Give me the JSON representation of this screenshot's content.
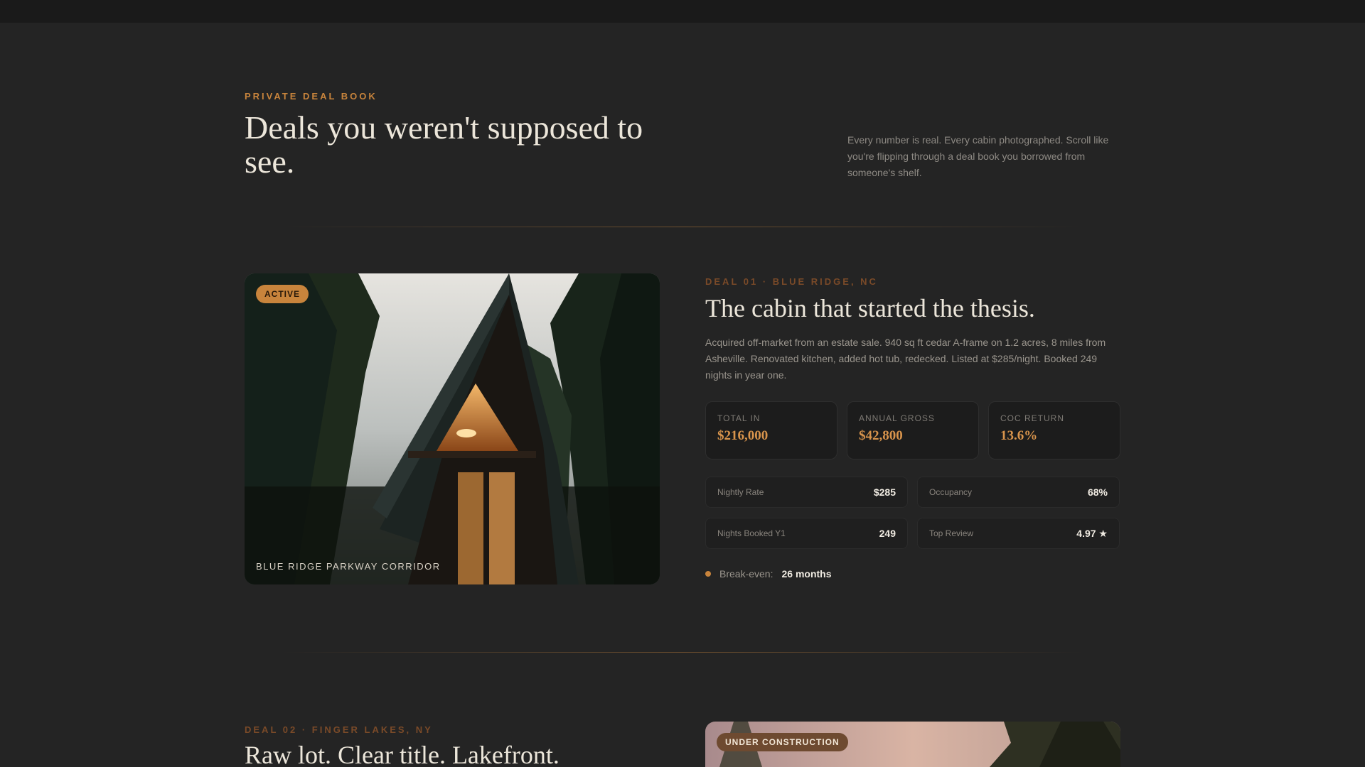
{
  "hero": {
    "eyebrow": "PRIVATE DEAL BOOK",
    "title": "Deals you weren't supposed to see.",
    "description": "Every number is real. Every cabin photographed. Scroll like you're flipping through a deal book you borrowed from someone's shelf."
  },
  "deal1": {
    "badge": "ACTIVE",
    "photo_caption": "BLUE RIDGE PARKWAY CORRIDOR",
    "kicker": "DEAL 01 · BLUE RIDGE, NC",
    "title": "The cabin that started the thesis.",
    "description": "Acquired off-market from an estate sale. 940 sq ft cedar A-frame on 1.2 acres, 8 miles from Asheville. Renovated kitchen, added hot tub, redecked. Listed at $285/night. Booked 249 nights in year one.",
    "stats": [
      {
        "label": "TOTAL IN",
        "value": "$216,000"
      },
      {
        "label": "ANNUAL GROSS",
        "value": "$42,800"
      },
      {
        "label": "COC RETURN",
        "value": "13.6%"
      }
    ],
    "metrics": [
      {
        "label": "Nightly Rate",
        "value": "$285"
      },
      {
        "label": "Occupancy",
        "value": "68%"
      },
      {
        "label": "Nights Booked Y1",
        "value": "249"
      },
      {
        "label": "Top Review",
        "value": "4.97 ★"
      }
    ],
    "breakeven_label": "Break-even:",
    "breakeven_value": "26 months"
  },
  "deal2": {
    "badge": "UNDER CONSTRUCTION",
    "kicker": "DEAL 02 · FINGER LAKES, NY",
    "title": "Raw lot. Clear title. Lakefront."
  },
  "colors": {
    "accent": "#c8843c",
    "background": "#242424",
    "card": "#1c1c1c"
  }
}
